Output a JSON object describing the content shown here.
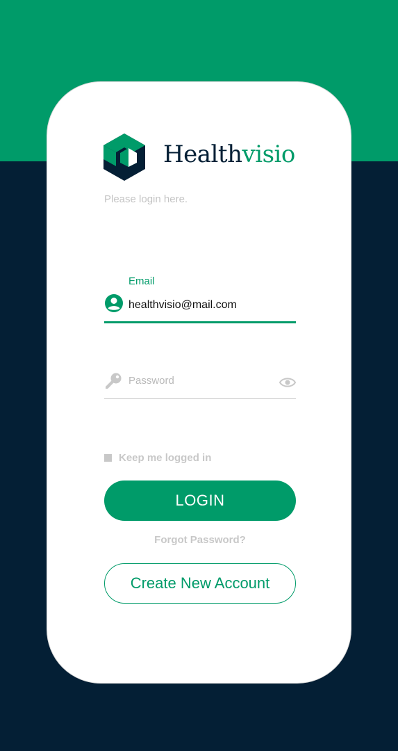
{
  "brand": {
    "name_part1": "Health",
    "name_part2": "visio",
    "logo_icon": "hexagon-logo-icon"
  },
  "login": {
    "subtitle": "Please login here.",
    "email": {
      "label": "Email",
      "value": "healthvisio@mail.com",
      "icon": "user-circle-icon"
    },
    "password": {
      "placeholder": "Password",
      "icon": "key-icon",
      "toggle_icon": "eye-icon"
    },
    "keep_logged_in_label": "Keep me logged in",
    "login_button_label": "LOGIN",
    "forgot_password_label": "Forgot Password?",
    "create_account_label": "Create New Account"
  },
  "colors": {
    "primary": "#009b69",
    "dark": "#041f35",
    "muted": "#c8c8c8"
  }
}
